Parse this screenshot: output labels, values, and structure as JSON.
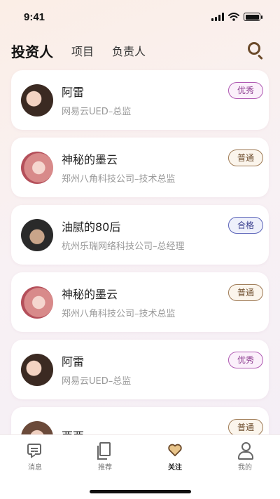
{
  "status_bar": {
    "time": "9:41"
  },
  "header": {
    "tabs": [
      {
        "label": "投资人"
      },
      {
        "label": "项目"
      },
      {
        "label": "负责人"
      }
    ]
  },
  "list": [
    {
      "name": "阿雷",
      "desc": "网易云UED–总监",
      "badge": "优秀"
    },
    {
      "name": "神秘的墨云",
      "desc": "郑州八角科技公司–技术总监",
      "badge": "普通"
    },
    {
      "name": "油腻的80后",
      "desc": "杭州乐瑞网络科技公司–总经理",
      "badge": "合格"
    },
    {
      "name": "神秘的墨云",
      "desc": "郑州八角科技公司–技术总监",
      "badge": "普通"
    },
    {
      "name": "阿雷",
      "desc": "网易云UED–总监",
      "badge": "优秀"
    },
    {
      "name": "西西",
      "desc": "",
      "badge": "普通"
    }
  ],
  "tabbar": [
    {
      "label": "消息",
      "icon": "message-icon"
    },
    {
      "label": "推荐",
      "icon": "recommend-icon"
    },
    {
      "label": "关注",
      "icon": "heart-icon"
    },
    {
      "label": "我的",
      "icon": "user-icon"
    }
  ],
  "colors": {
    "accent": "#6b4a2a",
    "badge_excellent": "#8c3b8f",
    "badge_normal": "#6b4a2a",
    "badge_pass": "#3a3f8f"
  }
}
